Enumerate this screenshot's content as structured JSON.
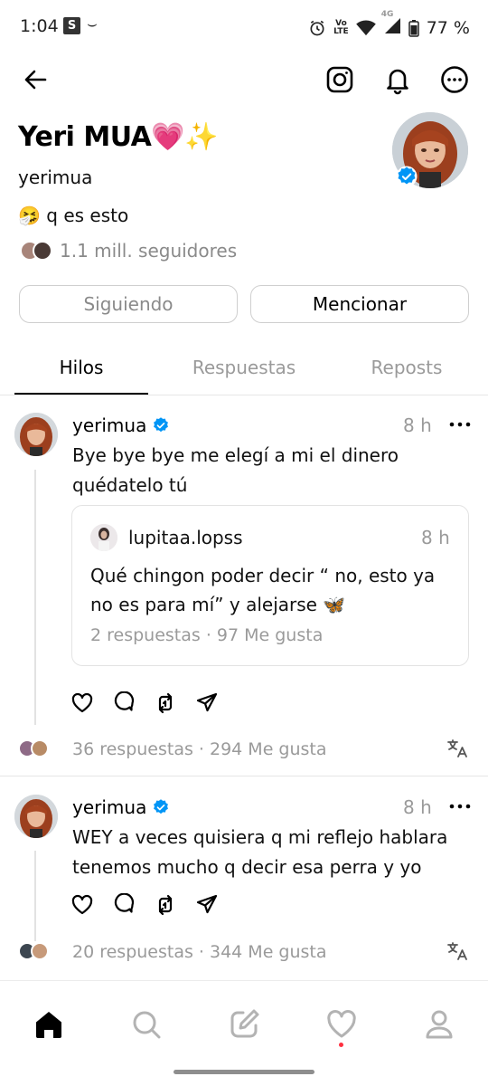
{
  "status_bar": {
    "time": "1:04",
    "s_badge": "S",
    "amazon_glyph": "⌣",
    "volte_top": "Vo",
    "volte_bottom": "LTE",
    "network": "4G",
    "battery": "77 %",
    "icons": [
      "alarm-icon",
      "volte-icon",
      "wifi-icon",
      "signal-icon",
      "battery-icon"
    ]
  },
  "top_bar": {
    "icons": [
      "back-arrow-icon",
      "instagram-icon",
      "bell-icon",
      "more-circle-icon"
    ]
  },
  "profile": {
    "display_name": "Yeri MUA",
    "name_emojis": "💗✨",
    "username": "yerimua",
    "bio_emoji": "🤧",
    "bio_text": "q es esto",
    "followers": "1.1 mill. seguidores",
    "verified": true
  },
  "buttons": {
    "following": "Siguiendo",
    "mention": "Mencionar"
  },
  "tabs": [
    {
      "label": "Hilos",
      "active": true
    },
    {
      "label": "Respuestas",
      "active": false
    },
    {
      "label": "Reposts",
      "active": false
    }
  ],
  "posts": [
    {
      "username": "yerimua",
      "time": "8 h",
      "text_line1": "Bye bye bye me elegí a mi el dinero",
      "text_line2": "quédatelo tú",
      "quote": {
        "username": "lupitaa.lopss",
        "time": "8 h",
        "text_line1": "Qué chingon poder decir “ no, esto ya",
        "text_line2": "no es para mí” y alejarse 🦋",
        "stats": "2 respuestas · 97 Me gusta"
      },
      "stats": "36 respuestas · 294 Me gusta"
    },
    {
      "username": "yerimua",
      "time": "8 h",
      "text_line1": "WEY a veces quisiera q mi reflejo hablara",
      "text_line2": "tenemos mucho q decir esa perra y yo",
      "stats": "20 respuestas · 344 Me gusta"
    }
  ],
  "bottom_nav": [
    "home-icon",
    "search-icon",
    "compose-icon",
    "heart-icon",
    "profile-icon"
  ],
  "colors": {
    "verified_blue": "#0095f6",
    "muted_text": "#9a9a9a",
    "notification_dot": "#ff3040"
  }
}
